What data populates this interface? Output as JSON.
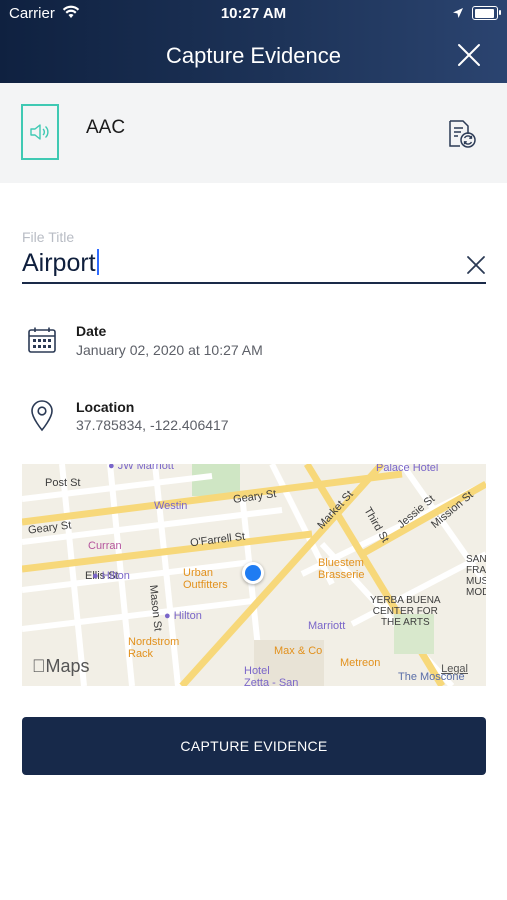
{
  "status_bar": {
    "carrier": "Carrier",
    "time": "10:27 AM"
  },
  "header": {
    "title": "Capture Evidence",
    "close_icon": "close-icon"
  },
  "media": {
    "type_icon": "speaker-icon",
    "name": "AAC",
    "action_icon": "replace-file-icon"
  },
  "file_title": {
    "label": "File Title",
    "value": "Airport"
  },
  "date": {
    "label": "Date",
    "value": "January 02, 2020 at 10:27 AM",
    "icon": "calendar-icon"
  },
  "location": {
    "label": "Location",
    "value": "37.785834, -122.406417",
    "icon": "location-pin-icon"
  },
  "map": {
    "streets": [
      "Post St",
      "Geary St",
      "Geary St",
      "O'Farrell St",
      "Ellis St",
      "Mason St",
      "Market St",
      "Third St",
      "Jessie St",
      "Mission St"
    ],
    "places": {
      "jw_marriott": "JW Marriott",
      "palace_hotel": "Palace Hotel",
      "westin": "Westin",
      "curran": "Curran",
      "hilton_1": "Hilton",
      "hilton_2": "Hilton",
      "urban_outfitters": "Urban\nOutfitters",
      "bluestem": "Bluestem\nBrasserie",
      "marriott": "Marriott",
      "yerba_buena": "YERBA BUENA\nCENTER FOR\nTHE ARTS",
      "sf_museum": "SAN\nFRA\nMUS\nMOD",
      "max_co": "Max & Co",
      "metreon": "Metreon",
      "nordstrom_rack": "Nordstrom\nRack",
      "hotel_zetta": "Hotel\nZetta - San",
      "moscone": "The Moscone"
    },
    "logo": "Maps",
    "legal": "Legal",
    "colors": {
      "road": "#ffffff",
      "major_road": "#f7d87a",
      "land": "#f2efe6",
      "poi_purple": "#8a72d8",
      "poi_orange": "#f2a23c",
      "user_dot": "#1f7cf2"
    }
  },
  "cta": {
    "label": "CAPTURE EVIDENCE"
  }
}
